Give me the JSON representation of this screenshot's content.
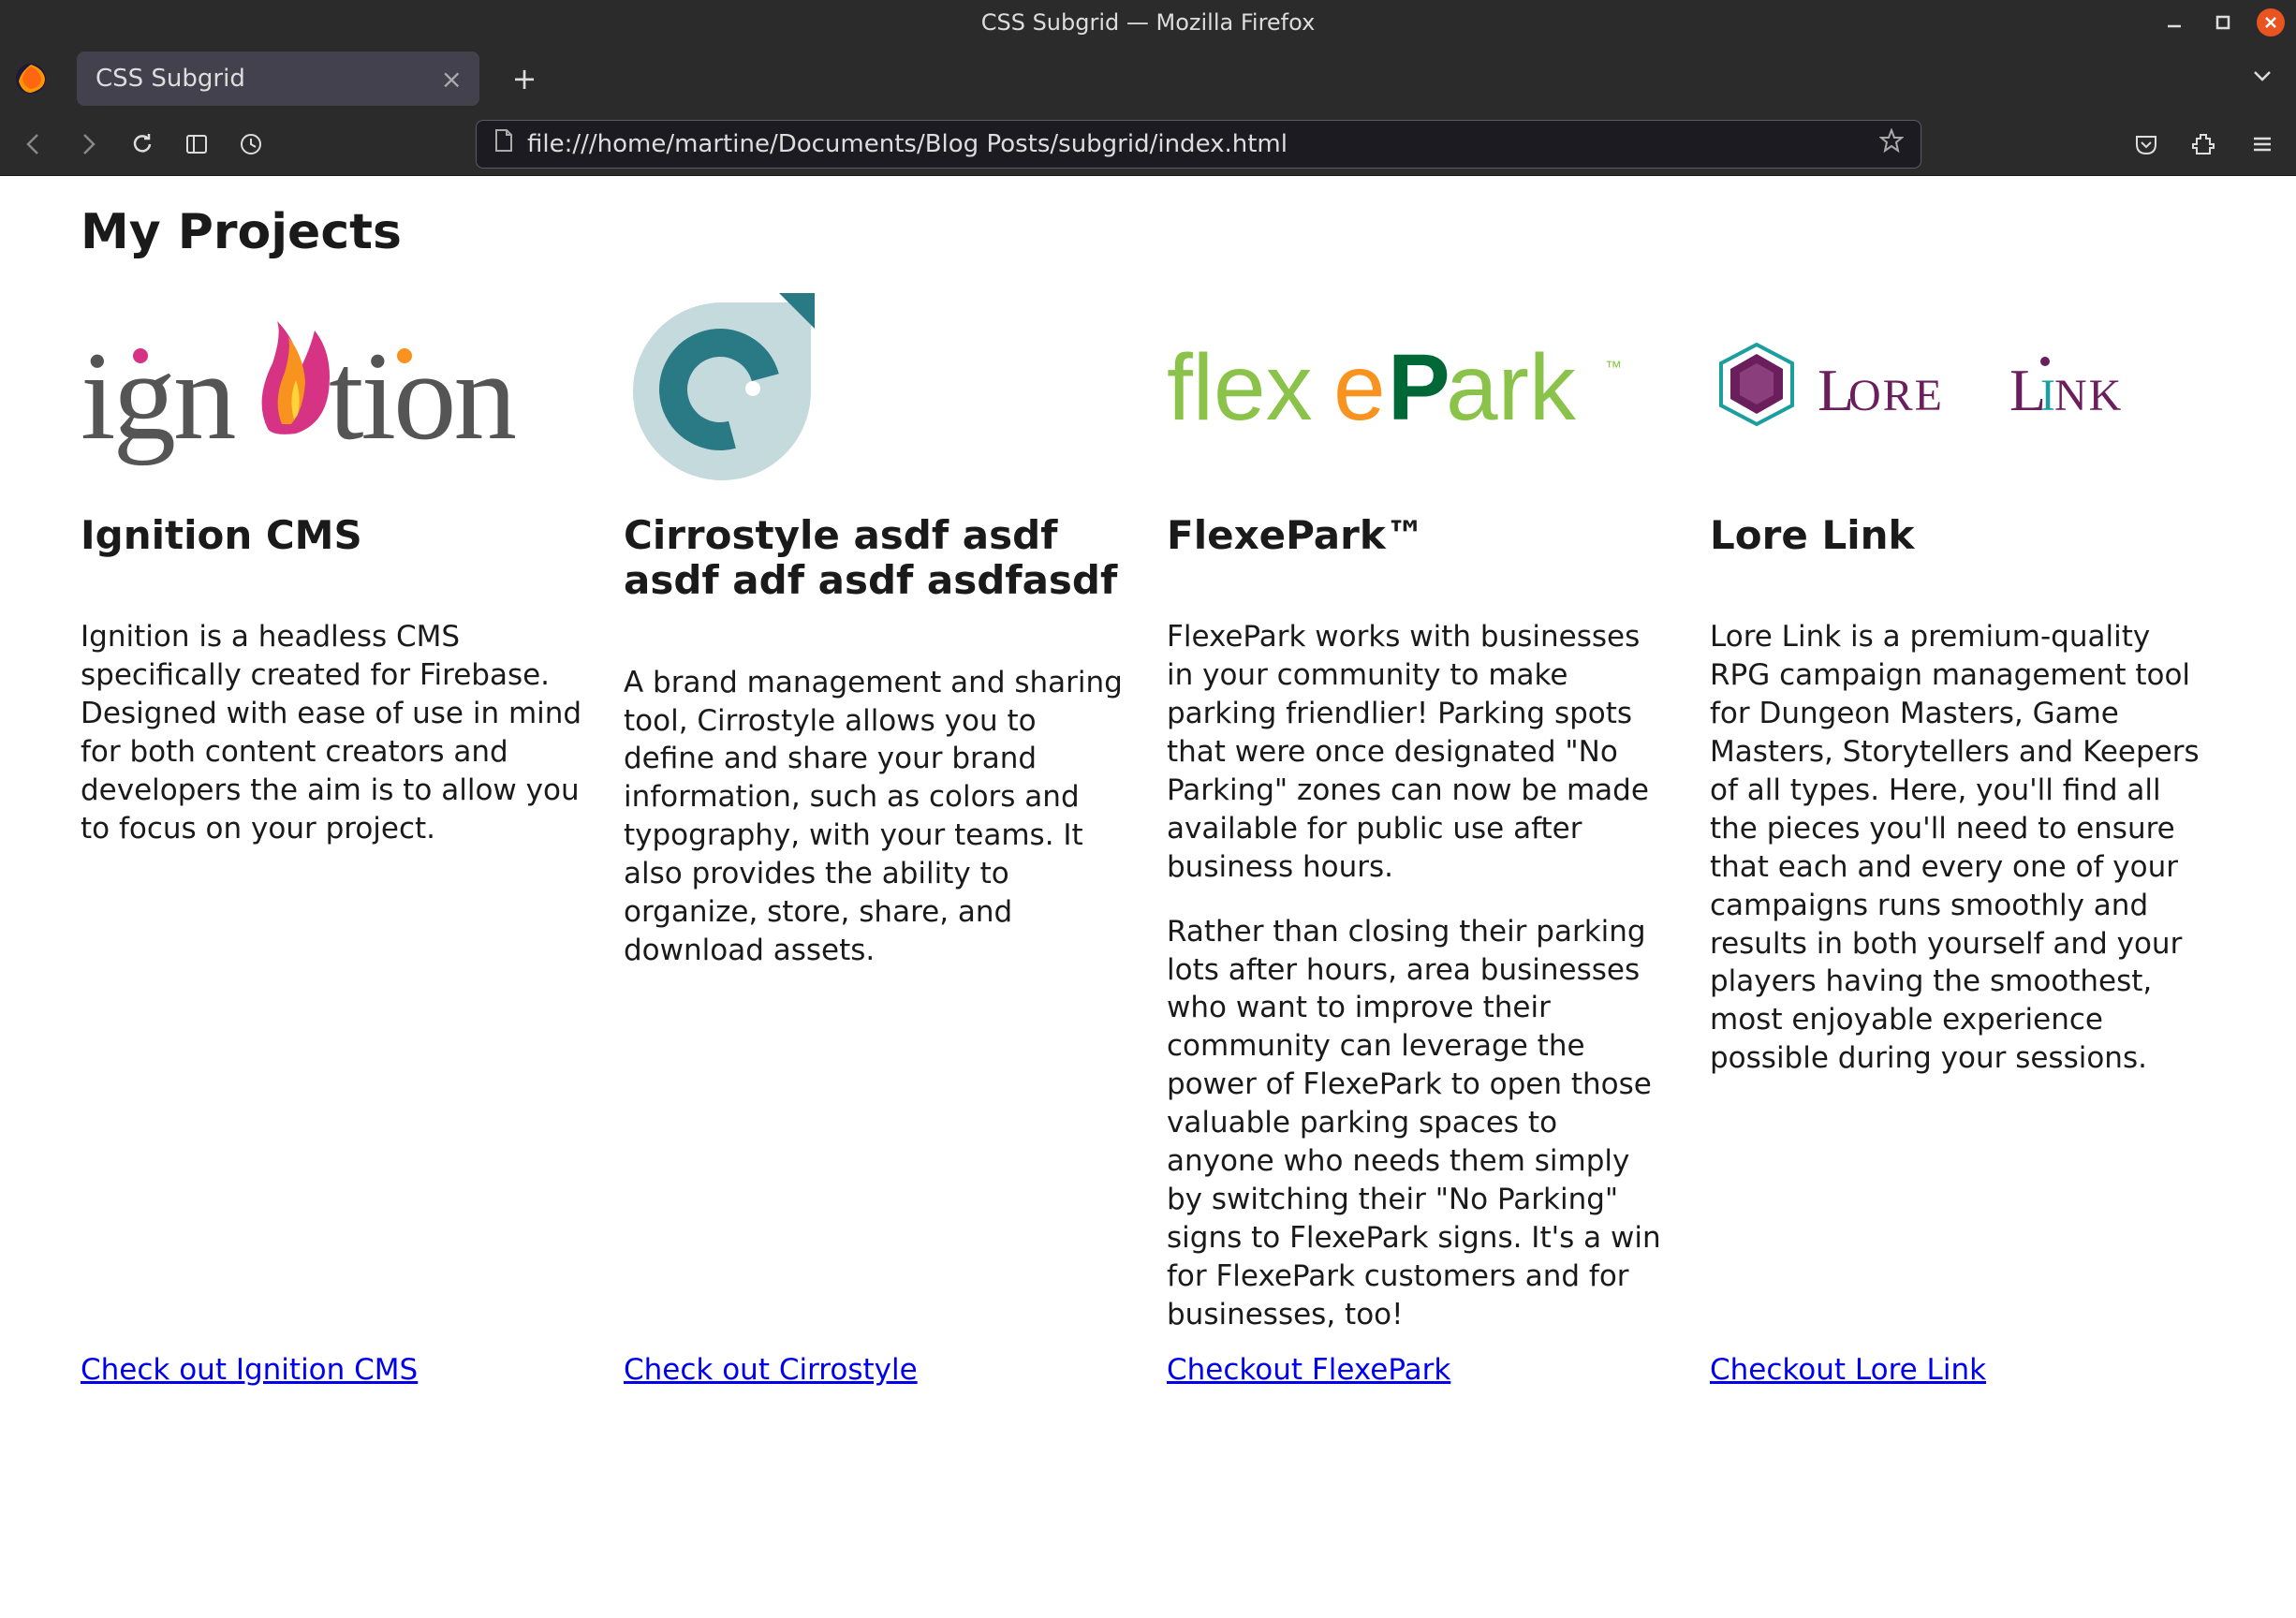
{
  "window": {
    "title": "CSS Subgrid — Mozilla Firefox"
  },
  "tab": {
    "title": "CSS Subgrid"
  },
  "url": "file:///home/martine/Documents/Blog Posts/subgrid/index.html",
  "page": {
    "heading": "My Projects",
    "projects": [
      {
        "title": "Ignition CMS",
        "desc_p1": "Ignition is a headless CMS specifically created for Firebase. Designed with ease of use in mind for both content creators and developers the aim is to allow you to focus on your project.",
        "link_text": "Check out Ignition CMS"
      },
      {
        "title": "Cirrostyle asdf asdf asdf adf asdf asdfasdf",
        "desc_p1": "A brand management and sharing tool, Cirrostyle allows you to define and share your brand information, such as colors and typography, with your teams. It also provides the ability to organize, store, share, and download assets.",
        "link_text": "Check out Cirrostyle"
      },
      {
        "title": "FlexePark™",
        "desc_p1": "FlexePark works with businesses in your community to make parking friendlier! Parking spots that were once designated \"No Parking\" zones can now be made available for public use after business hours.",
        "desc_p2": "Rather than closing their parking lots after hours, area businesses who want to improve their community can leverage the power of FlexePark to open those valuable parking spaces to anyone who needs them simply by switching their \"No Parking\" signs to FlexePark signs. It's a win for FlexePark customers and for businesses, too!",
        "link_text": "Checkout FlexePark"
      },
      {
        "title": "Lore Link",
        "desc_p1": "Lore Link is a premium-quality RPG campaign management tool for Dungeon Masters, Game Masters, Storytellers and Keepers of all types. Here, you'll find all the pieces you'll need to ensure that each and every one of your campaigns runs smoothly and results in both yourself and your players having the smoothest, most enjoyable experience possible during your sessions.",
        "link_text": "Checkout Lore Link"
      }
    ]
  }
}
